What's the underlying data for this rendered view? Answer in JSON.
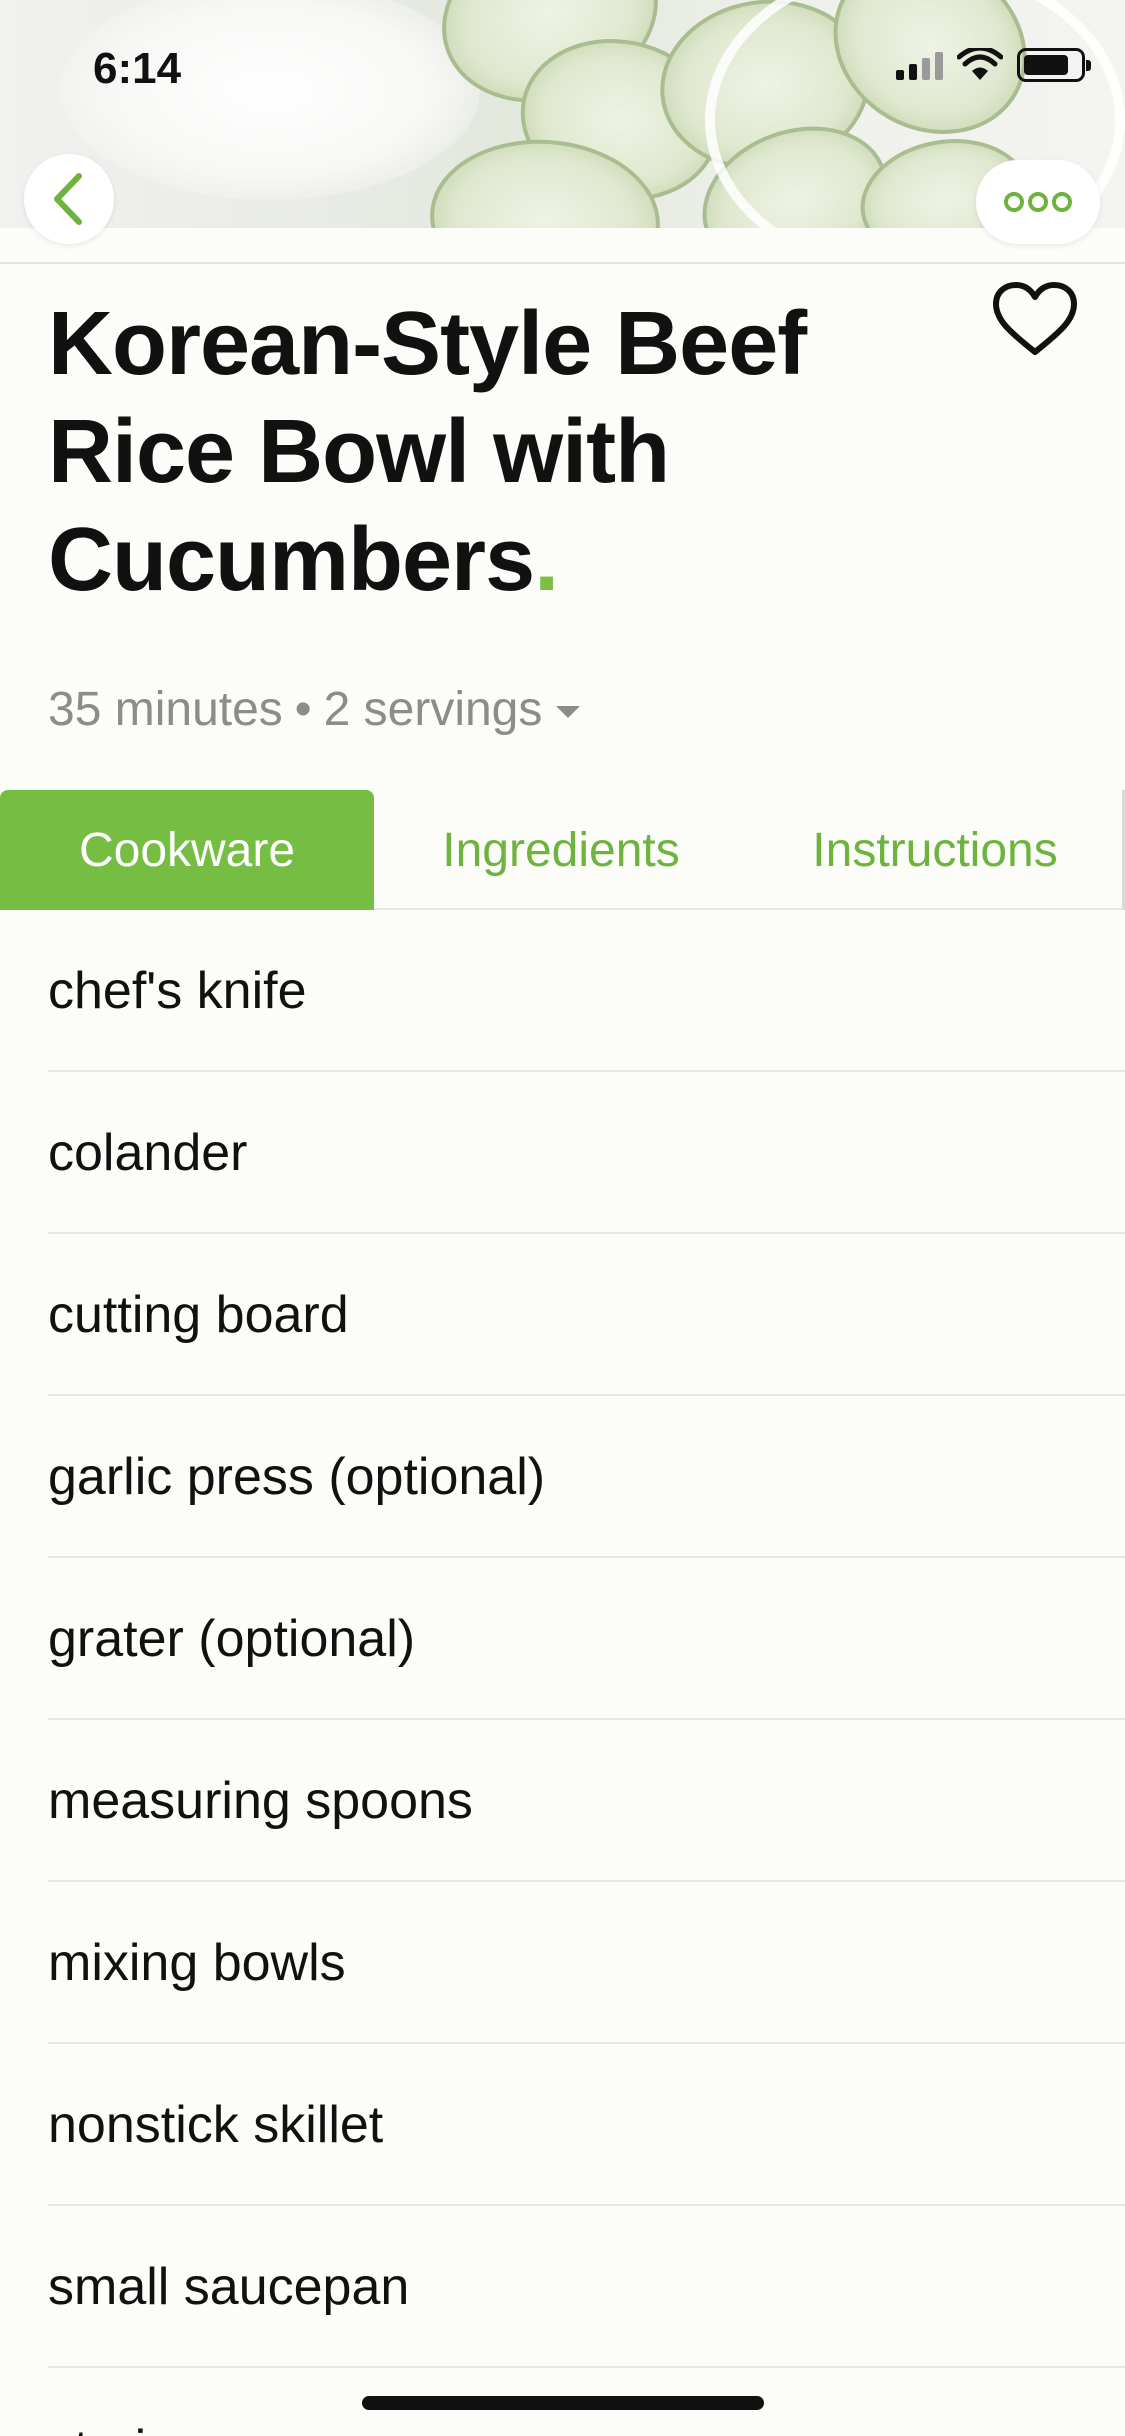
{
  "status_bar": {
    "time": "6:14"
  },
  "recipe": {
    "title": "Korean-Style Beef Rice Bowl with Cucumbers",
    "title_dot": ".",
    "duration": "35 minutes",
    "separator": "•",
    "servings": "2 servings"
  },
  "tabs": [
    {
      "label": "Cookware",
      "active": true
    },
    {
      "label": "Ingredients",
      "active": false
    },
    {
      "label": "Instructions",
      "active": false
    }
  ],
  "cookware": [
    "chef's knife",
    "colander",
    "cutting board",
    "garlic press (optional)",
    "grater (optional)",
    "measuring spoons",
    "mixing bowls",
    "nonstick skillet",
    "small saucepan",
    "strainer"
  ],
  "icons": {
    "back": "chevron-left-icon",
    "more": "more-dots-icon",
    "favorite": "heart-outline-icon",
    "signal": "signal-icon",
    "wifi": "wifi-icon",
    "battery": "battery-icon"
  },
  "colors": {
    "accent": "#76bd43",
    "accent_text": "#6fb33f",
    "background": "#fcfcf9",
    "muted_text": "#8c8c8c"
  }
}
